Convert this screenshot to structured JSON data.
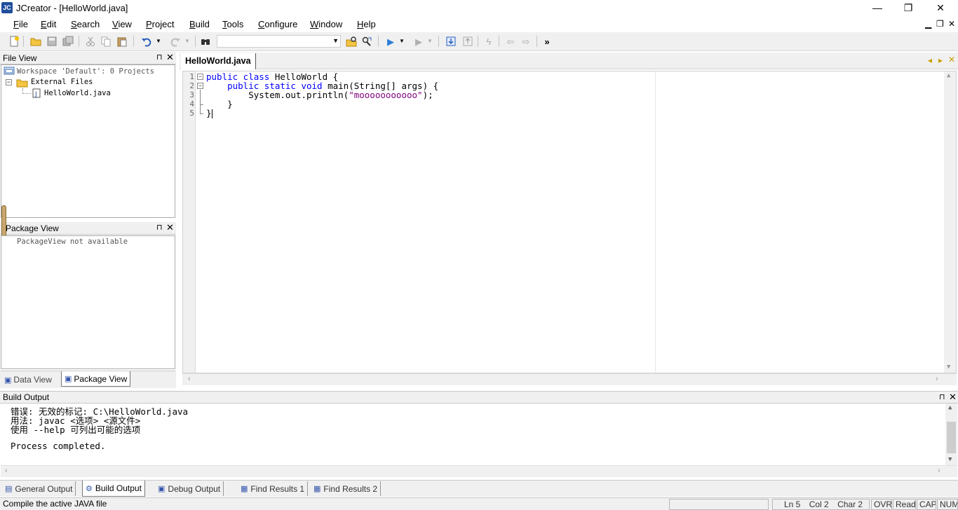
{
  "window": {
    "title": "JCreator - [HelloWorld.java]",
    "app_icon_text": "JC",
    "minimize_glyph": "—",
    "restore_glyph": "❐",
    "close_glyph": "✕"
  },
  "menu": {
    "items": [
      {
        "accel": "F",
        "rest": "ile"
      },
      {
        "accel": "E",
        "rest": "dit"
      },
      {
        "accel": "S",
        "rest": "earch"
      },
      {
        "accel": "V",
        "rest": "iew"
      },
      {
        "accel": "P",
        "rest": "roject"
      },
      {
        "accel": "B",
        "rest": "uild"
      },
      {
        "accel": "T",
        "rest": "ools"
      },
      {
        "accel": "C",
        "rest": "onfigure"
      },
      {
        "accel": "W",
        "rest": "indow"
      },
      {
        "accel": "H",
        "rest": "elp"
      }
    ],
    "mdi_minimize": "▁",
    "mdi_restore": "❐",
    "mdi_close": "✕"
  },
  "toolbar": {
    "find_value": "",
    "overflow_glyph": "»"
  },
  "file_view": {
    "title": "File View",
    "pin_glyph": "⊓",
    "close_glyph": "✕",
    "workspace": "Workspace 'Default': 0 Projects",
    "folder": "External Files",
    "file": "HelloWorld.java"
  },
  "package_view": {
    "title": "Package View",
    "pin_glyph": "⊓",
    "close_glyph": "✕",
    "message": "PackageView not available"
  },
  "left_tabs": [
    {
      "label": "Data View"
    },
    {
      "label": "Package View"
    }
  ],
  "editor": {
    "tab_label": "HelloWorld.java",
    "nav_prev": "◂",
    "nav_next": "▸",
    "close_glyph": "✕",
    "line_numbers": [
      "1",
      "2",
      "3",
      "4",
      "5"
    ],
    "code": {
      "l1_kw": "public class",
      "l1_rest": " HelloWorld {",
      "l2_indent": "    ",
      "l2_kw": "public static void",
      "l2_rest": " main(String[] args) {",
      "l3_pre": "        System.out.println(",
      "l3_str": "\"mooooooooooo\"",
      "l3_post": ");",
      "l4": "    }",
      "l5": "}"
    }
  },
  "build_output": {
    "title": "Build Output",
    "pin_glyph": "⊓",
    "close_glyph": "✕",
    "lines": [
      "错误: 无效的标记: C:\\HelloWorld.java",
      "用法: javac <选项> <源文件>",
      "使用 --help 可列出可能的选项",
      "",
      "Process completed."
    ]
  },
  "output_tabs": [
    {
      "label": "General Output"
    },
    {
      "label": "Build Output"
    },
    {
      "label": "Debug Output"
    },
    {
      "label": "Find Results 1"
    },
    {
      "label": "Find Results 2"
    }
  ],
  "status": {
    "message": "Compile the active JAVA file",
    "ln": "Ln 5",
    "col": "Col 2",
    "char": "Char 2",
    "ovr": "OVR",
    "read": "Read",
    "cap": "CAP",
    "num": "NUM"
  }
}
